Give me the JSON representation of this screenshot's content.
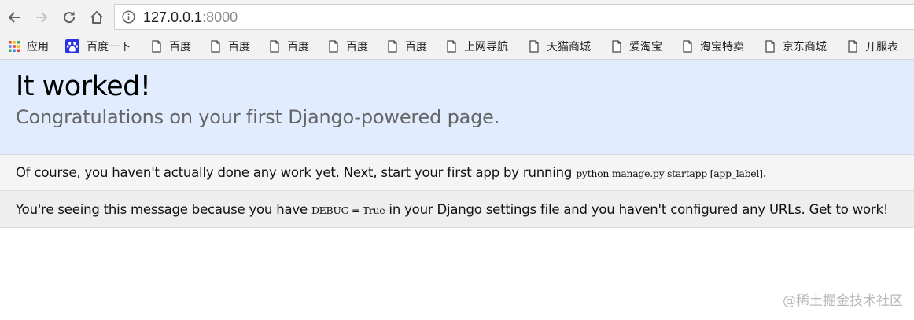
{
  "browser": {
    "url_host": "127.0.0.1",
    "url_port": ":8000",
    "bookmarks": [
      {
        "label": "应用",
        "icon": "apps-grid-icon"
      },
      {
        "label": "百度一下",
        "icon": "baidu-paw-icon"
      },
      {
        "label": "百度",
        "icon": "page-icon"
      },
      {
        "label": "百度",
        "icon": "page-icon"
      },
      {
        "label": "百度",
        "icon": "page-icon"
      },
      {
        "label": "百度",
        "icon": "page-icon"
      },
      {
        "label": "百度",
        "icon": "page-icon"
      },
      {
        "label": "上网导航",
        "icon": "page-icon"
      },
      {
        "label": "天猫商城",
        "icon": "page-icon"
      },
      {
        "label": "爱淘宝",
        "icon": "page-icon"
      },
      {
        "label": "淘宝特卖",
        "icon": "page-icon"
      },
      {
        "label": "京东商城",
        "icon": "page-icon"
      },
      {
        "label": "开服表",
        "icon": "page-icon"
      }
    ]
  },
  "page": {
    "title": "It worked!",
    "subtitle": "Congratulations on your first Django-powered page.",
    "instructions_pre": "Of course, you haven't actually done any work yet. Next, start your first app by running ",
    "instructions_code": "python manage.py startapp [app_label]",
    "instructions_post": ".",
    "explanation_pre": "You're seeing this message because you have ",
    "explanation_code": "DEBUG = True",
    "explanation_post": " in your Django settings file and you haven't configured any URLs. Get to work!"
  },
  "watermark": "@稀土掘金技术社区"
}
